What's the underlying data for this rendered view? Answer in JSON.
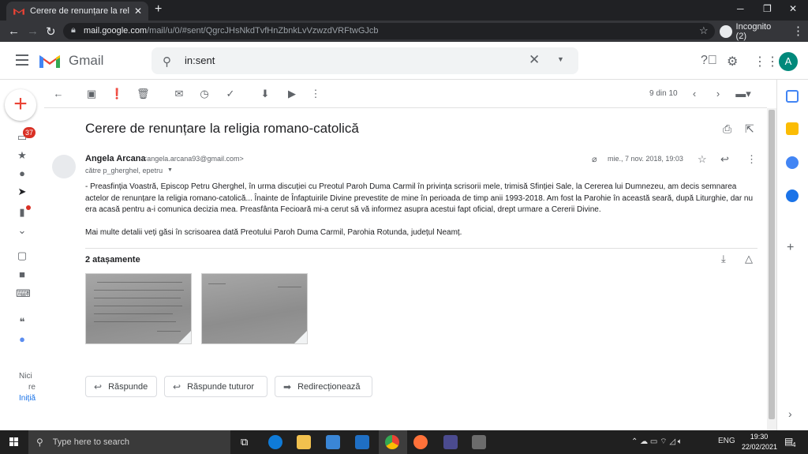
{
  "browser": {
    "tab_title": "Cerere de renunțare la religia ro",
    "url_host": "mail.google.com",
    "url_path": "/mail/u/0/#sent/QgrcJHsNkdTvfHnZbnkLvVzwzdVRFtwGJcb",
    "incognito_label": "Incognito (2)"
  },
  "gmail": {
    "logo_text": "Gmail",
    "search_query": "in:sent",
    "avatar_letter": "A"
  },
  "sidebar": {
    "inbox_badge": "37",
    "footer_lines": [
      "Nici",
      "re",
      "Inițiă"
    ]
  },
  "toolbar": {
    "pager": "9 din 10"
  },
  "message": {
    "subject": "Cerere de renunțare la religia romano-catolică",
    "sender_name": "Angela Arcana",
    "sender_email": "<angela.arcana93@gmail.com>",
    "recipients": "către p_gherghel, epetru",
    "date": "mie., 7 nov. 2018, 19:03",
    "body_p1": "- Preasfinția Voastră, Episcop Petru Gherghel, în urma discuției cu Preotul Paroh Duma Carmil în privința scrisorii mele, trimisă Sfinției Sale, la Cererea lui Dumnezeu, am decis semnarea actelor de renunțare la religia romano-catolică... Înainte de Înfaptuirile Divine prevestite de mine în perioada de timp anii 1993-2018. Am fost la Parohie în această seară, după Liturghie, dar nu era acasă pentru a-i comunica decizia mea. Preasfânta Fecioară mi-a cerut să vă informez asupra acestui fapt oficial, drept urmare a Cererii Divine.",
    "body_p2": "Mai multe detalii veți găsi în scrisoarea dată Preotului Paroh Duma Carmil, Parohia Rotunda, județul Neamț.",
    "attachments_title": "2 atașamente"
  },
  "actions": {
    "reply": "Răspunde",
    "reply_all": "Răspunde tuturor",
    "forward": "Redirecționează"
  },
  "taskbar": {
    "search_placeholder": "Type here to search",
    "lang": "ENG",
    "time": "19:30",
    "date": "22/02/2021",
    "notif_count": "4"
  }
}
